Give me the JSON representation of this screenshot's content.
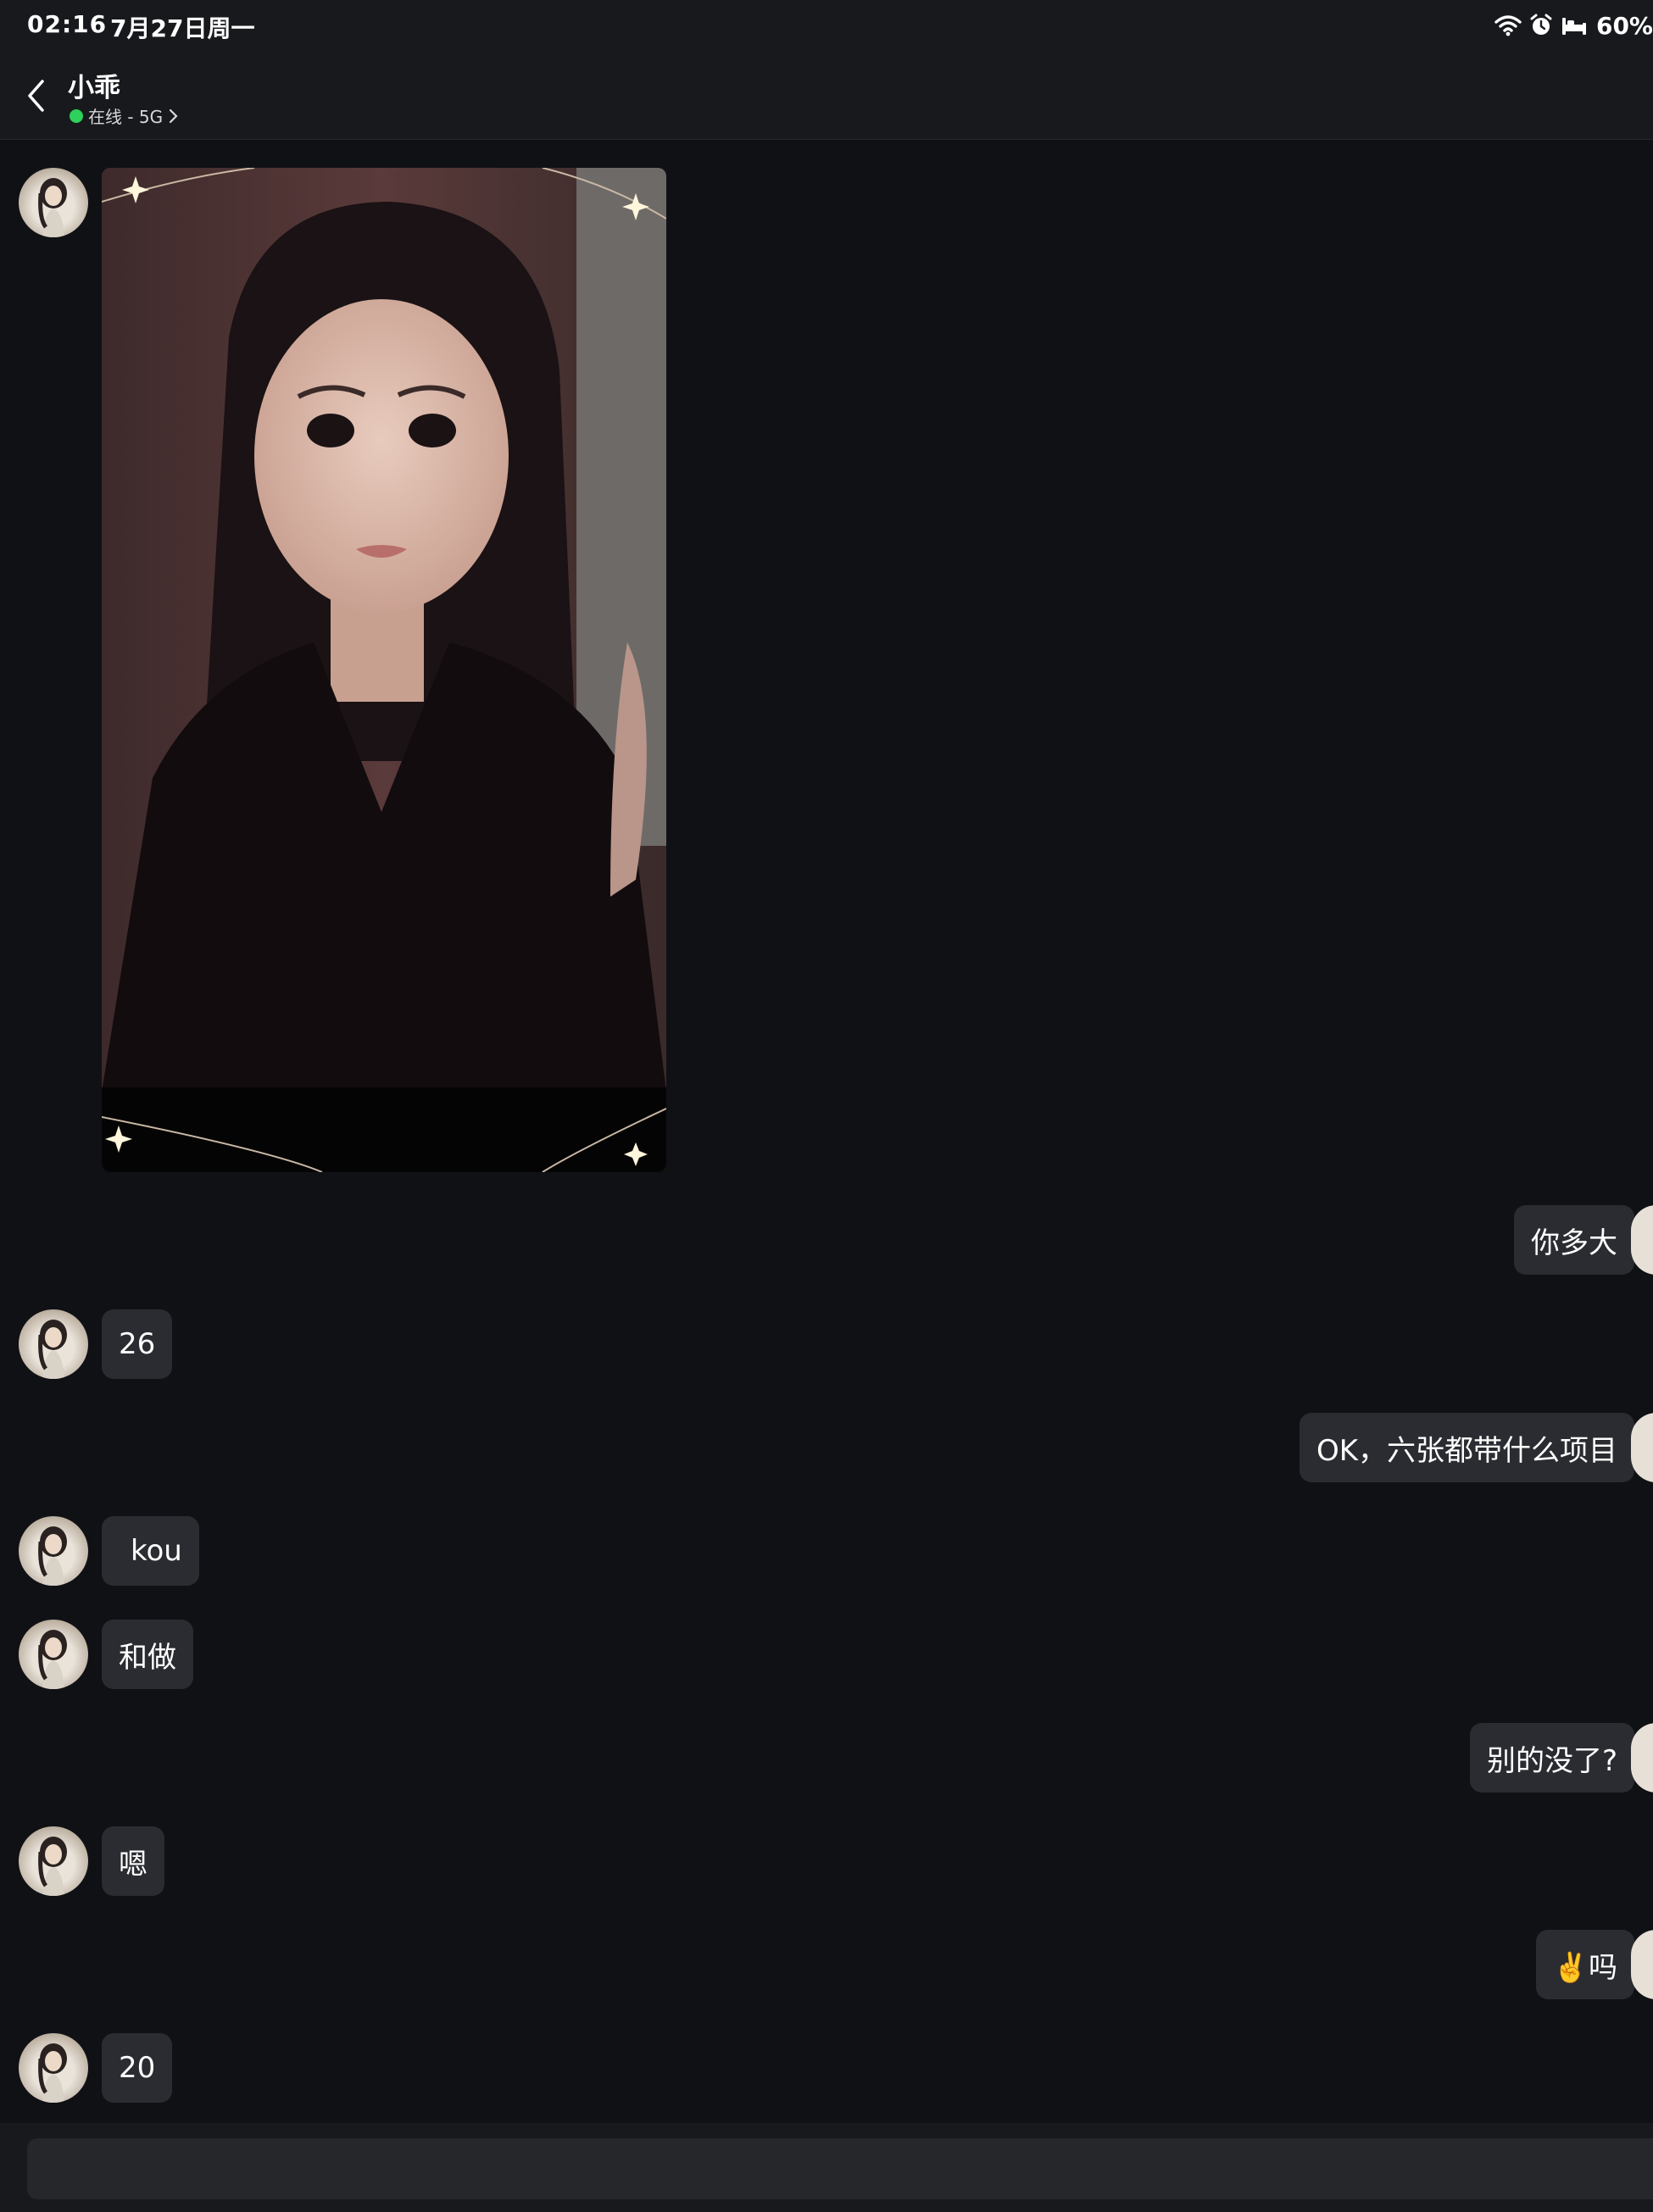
{
  "status_bar": {
    "time": "02:16",
    "date": "7月27日周一",
    "battery": "60%",
    "icons": [
      "wifi-icon",
      "alarm-icon",
      "bed-icon"
    ]
  },
  "header": {
    "contact_name": "小乖",
    "presence": "在线 - 5G",
    "presence_color": "#2ed15b"
  },
  "messages": [
    {
      "side": "in",
      "type": "photo"
    },
    {
      "side": "out",
      "text": "你多大"
    },
    {
      "side": "in",
      "text": "26"
    },
    {
      "side": "out",
      "text": "OK，六张都带什么项目"
    },
    {
      "side": "in",
      "text": "kou"
    },
    {
      "side": "in",
      "text": "和做"
    },
    {
      "side": "out",
      "text": "别的没了?"
    },
    {
      "side": "in",
      "text": "嗯"
    },
    {
      "side": "out",
      "text": "✌️吗"
    },
    {
      "side": "in",
      "text": "20"
    }
  ],
  "composer": {
    "placeholder": ""
  },
  "colors": {
    "background": "#101115",
    "bubble": "#2b2c31",
    "bar": "#18191d"
  }
}
